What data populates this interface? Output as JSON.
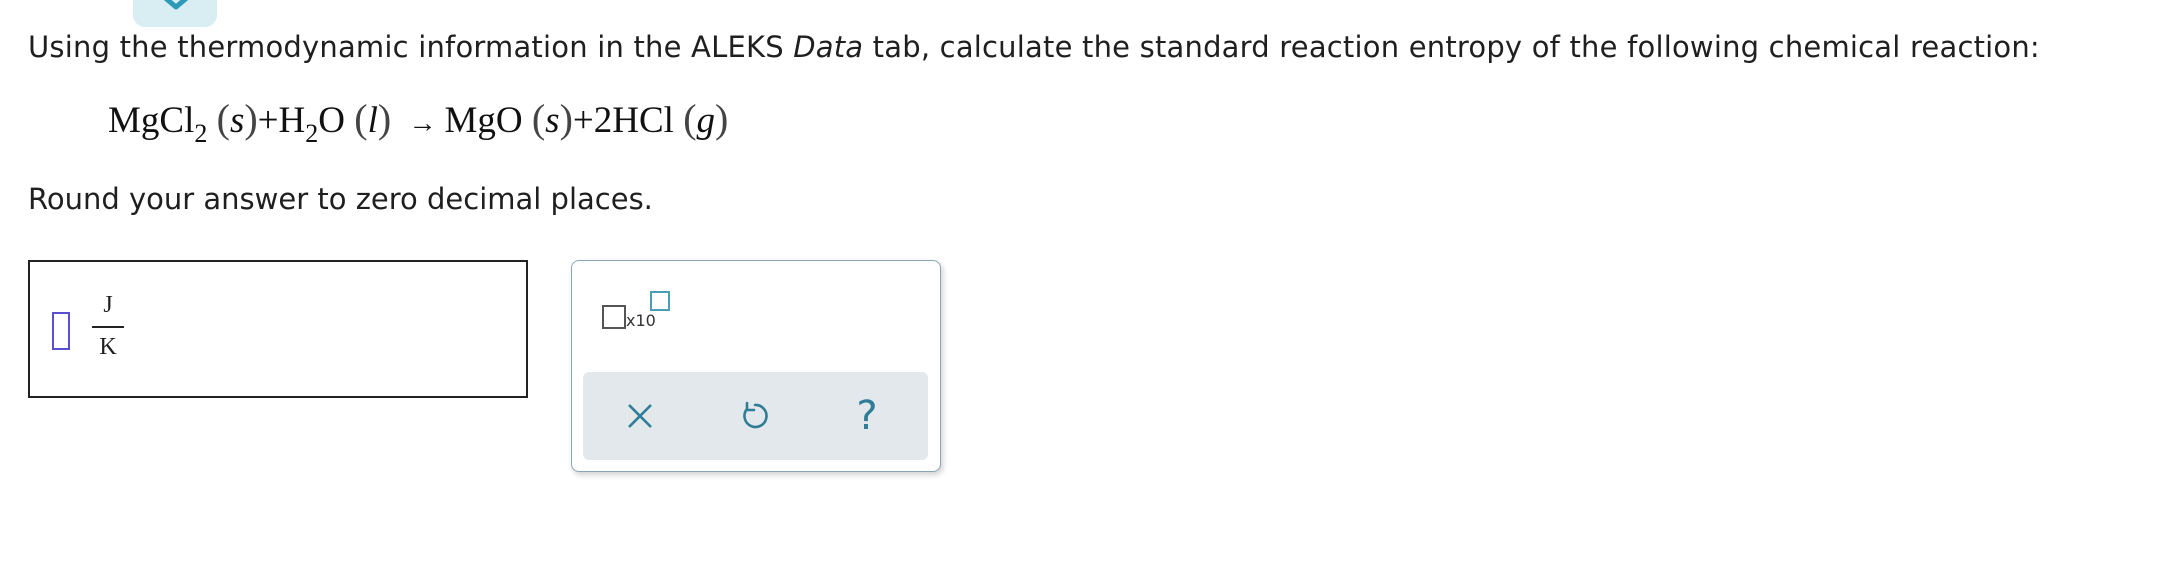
{
  "question": {
    "prefix": "Using the thermodynamic information in the ALEKS ",
    "italic": "Data",
    "suffix": " tab, calculate the standard reaction entropy of the following chemical reaction:"
  },
  "equation": {
    "reactant1": "MgCl",
    "reactant1_sub": "2",
    "reactant1_phase": "s",
    "plus1": "+",
    "reactant2_a": "H",
    "reactant2_sub": "2",
    "reactant2_b": "O",
    "reactant2_phase": "l",
    "arrow": "→",
    "product1": "MgO",
    "product1_phase": "s",
    "plus2": "+",
    "product2": "2HCl",
    "product2_phase": "g"
  },
  "instruction": "Round your answer to zero decimal places.",
  "answer": {
    "value": "",
    "unit_numerator": "J",
    "unit_denominator": "K"
  },
  "tools": {
    "sci_label": "x10",
    "help_label": "?"
  },
  "colors": {
    "accent": "#2f7d97",
    "tab_bg": "#d9eef3",
    "cursor": "#5a4fcf",
    "action_bar": "#e3e8ec"
  }
}
